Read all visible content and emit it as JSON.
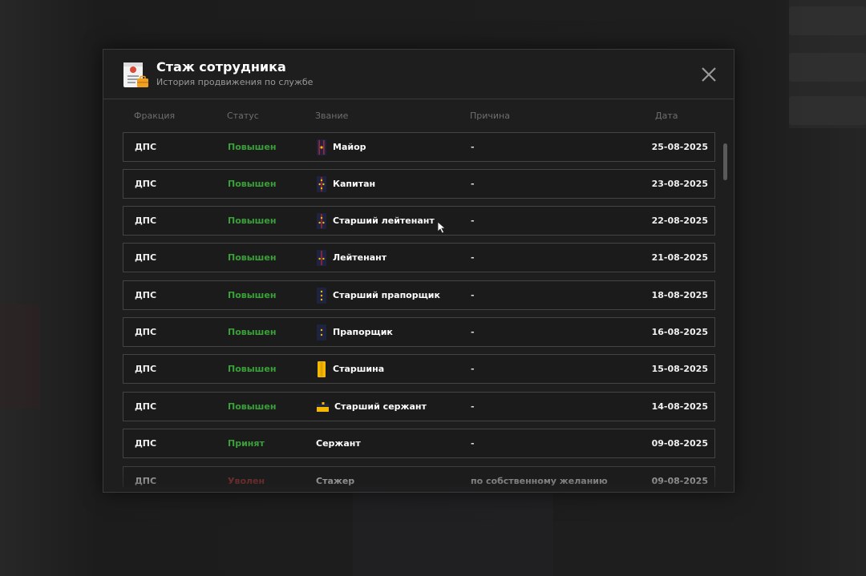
{
  "modal": {
    "title": "Стаж сотрудника",
    "subtitle": "История продвижения по службе",
    "header_icon": "document-briefcase-icon",
    "close_icon": "close-icon"
  },
  "columns": {
    "faction": "Фракция",
    "status": "Статус",
    "rank": "Звание",
    "reason": "Причина",
    "date": "Дата"
  },
  "rows": [
    {
      "faction": "ДПС",
      "status": "Повышен",
      "status_type": "up",
      "rank": "Майор",
      "rank_icon": "major-insignia-icon",
      "reason": "-",
      "date": "25-08-2025"
    },
    {
      "faction": "ДПС",
      "status": "Повышен",
      "status_type": "up",
      "rank": "Капитан",
      "rank_icon": "captain-insignia-icon",
      "reason": "-",
      "date": "23-08-2025"
    },
    {
      "faction": "ДПС",
      "status": "Повышен",
      "status_type": "up",
      "rank": "Старший лейтенант",
      "rank_icon": "senior-lieutenant-insignia-icon",
      "reason": "-",
      "date": "22-08-2025"
    },
    {
      "faction": "ДПС",
      "status": "Повышен",
      "status_type": "up",
      "rank": "Лейтенант",
      "rank_icon": "lieutenant-insignia-icon",
      "reason": "-",
      "date": "21-08-2025"
    },
    {
      "faction": "ДПС",
      "status": "Повышен",
      "status_type": "up",
      "rank": "Старший прапорщик",
      "rank_icon": "senior-warrant-officer-insignia-icon",
      "reason": "-",
      "date": "18-08-2025"
    },
    {
      "faction": "ДПС",
      "status": "Повышен",
      "status_type": "up",
      "rank": "Прапорщик",
      "rank_icon": "warrant-officer-insignia-icon",
      "reason": "-",
      "date": "16-08-2025"
    },
    {
      "faction": "ДПС",
      "status": "Повышен",
      "status_type": "up",
      "rank": "Старшина",
      "rank_icon": "sergeant-major-insignia-icon",
      "reason": "-",
      "date": "15-08-2025"
    },
    {
      "faction": "ДПС",
      "status": "Повышен",
      "status_type": "up",
      "rank": "Старший сержант",
      "rank_icon": "senior-sergeant-insignia-icon",
      "reason": "-",
      "date": "14-08-2025"
    },
    {
      "faction": "ДПС",
      "status": "Принят",
      "status_type": "accepted",
      "rank": "Сержант",
      "rank_icon": "",
      "reason": "-",
      "date": "09-08-2025"
    },
    {
      "faction": "ДПС",
      "status": "Уволен",
      "status_type": "fired",
      "rank": "Стажер",
      "rank_icon": "",
      "reason": "по собственному желанию",
      "date": "09-08-2025"
    }
  ],
  "colors": {
    "status_up": "#3aa13a",
    "status_fired": "#b03a3a",
    "insignia_gold": "#f5b800",
    "insignia_dark": "#1e2340",
    "insignia_red": "#c0283a"
  }
}
